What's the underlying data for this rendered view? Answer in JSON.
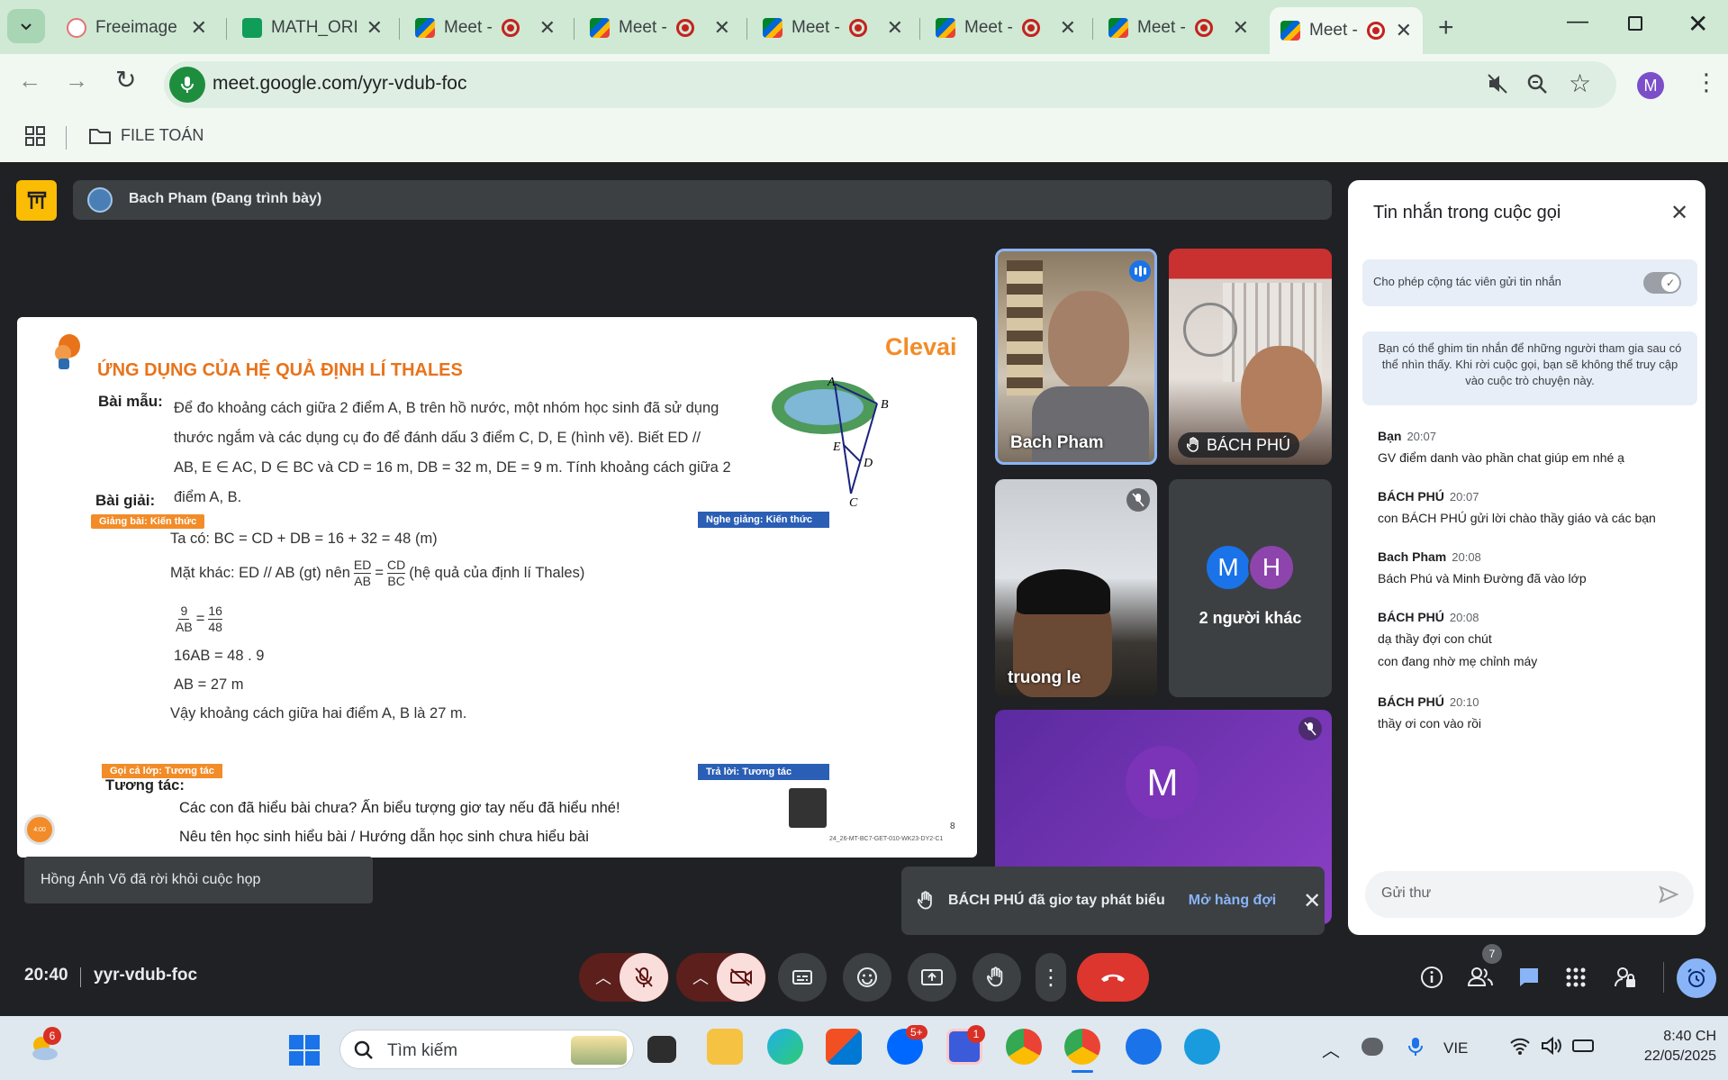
{
  "browser": {
    "tabs": [
      {
        "label": "Freeimage",
        "type": "free"
      },
      {
        "label": "MATH_ORI",
        "type": "sheet"
      },
      {
        "label": "Meet -",
        "type": "meet"
      },
      {
        "label": "Meet -",
        "type": "meet"
      },
      {
        "label": "Meet -",
        "type": "meet"
      },
      {
        "label": "Meet -",
        "type": "meet"
      },
      {
        "label": "Meet -",
        "type": "meet"
      },
      {
        "label": "Meet -",
        "type": "meet",
        "active": true
      }
    ],
    "url": "meet.google.com/yyr-vdub-foc",
    "bookmark_folder": "FILE TOÁN",
    "profile_initial": "M",
    "colors": {
      "tabbar": "#cfe9d4",
      "toolbar": "#f1f8f2"
    }
  },
  "presenter_bar": {
    "label": "Bach Pham (Đang trình bày)"
  },
  "slide": {
    "brand": "Clevai",
    "title": "ỨNG DỤNG CỦA HỆ QUẢ ĐỊNH LÍ THALES",
    "example_label": "Bài mẫu:",
    "example_text_lines": [
      "Để đo khoảng cách giữa 2 điểm A, B trên hồ nước, một nhóm học sinh đã sử dụng",
      "thước ngắm và các dụng cụ đo để đánh dấu 3 điểm C, D, E (hình vẽ). Biết ED //",
      "AB, E ∈ AC, D ∈ BC và CD = 16 m, DB = 32 m, DE = 9 m. Tính khoảng cách giữa 2",
      "điểm A, B."
    ],
    "solution_label": "Bài giải:",
    "tag_teach": "Giảng bài: Kiến thức",
    "tag_listen": "Nghe giảng: Kiến thức",
    "solution_lines": {
      "l1": "Ta có: BC = CD + DB = 16 + 32 = 48 (m)",
      "l2_a": "Mặt khác: ED // AB (gt) nên",
      "l2_frac1_num": "ED",
      "l2_frac1_den": "AB",
      "l2_eq": "=",
      "l2_frac2_num": "CD",
      "l2_frac2_den": "BC",
      "l2_b": "(hệ quả của định lí Thales)",
      "l3_frac1_num": "9",
      "l3_frac1_den": "AB",
      "l3_eq": "=",
      "l3_frac2_num": "16",
      "l3_frac2_den": "48",
      "l4": "16AB = 48 . 9",
      "l5": "AB = 27 m",
      "l6": "Vậy khoảng cách giữa hai điểm A, B là 27 m."
    },
    "tag_call": "Gọi cả lớp: Tương tác",
    "tag_answer": "Trả lời: Tương tác",
    "interaction_label": "Tương tác:",
    "interaction_lines": [
      "Các con đã hiểu bài chưa? Ấn biểu tượng giơ tay nếu đã hiểu nhé!",
      "Nêu tên học sinh hiểu bài / Hướng dẫn học sinh chưa hiểu bài"
    ],
    "page_number": "8",
    "footer_code": "24_26-MT-BC7-GET-010-WK23-DY2-C1",
    "figure_points": {
      "A": "A",
      "B": "B",
      "C": "C",
      "D": "D",
      "E": "E"
    },
    "timer": "4:00"
  },
  "participants": [
    {
      "name": "Bach Pham",
      "speaking": true
    },
    {
      "name": "BÁCH PHÚ",
      "hand_raised": true
    },
    {
      "name": "truong le",
      "muted": true
    },
    {
      "name": "2 người khác",
      "avatars": [
        "M",
        "H"
      ],
      "avatar_colors": [
        "#1a73e8",
        "#8e44ad"
      ]
    },
    {
      "name": "M",
      "muted": true,
      "avatar": "M"
    }
  ],
  "toast_left": "Hồng Ánh Võ đã rời khỏi cuộc họp",
  "toast_hand": {
    "text": "BÁCH PHÚ đã giơ tay phát biểu",
    "action": "Mở hàng đợi"
  },
  "chat": {
    "title": "Tin nhắn trong cuộc gọi",
    "toggle_label": "Cho phép cộng tác viên gửi tin nhắn",
    "info": "Bạn có thể ghim tin nhắn để những người tham gia sau có thể nhìn thấy. Khi rời cuộc gọi, bạn sẽ không thể truy cập vào cuộc trò chuyện này.",
    "messages": [
      {
        "who": "Bạn",
        "time": "20:07",
        "lines": [
          "GV điểm danh vào phần chat giúp em nhé ạ"
        ]
      },
      {
        "who": "BÁCH PHÚ",
        "time": "20:07",
        "lines": [
          "con  BÁCH PHÚ gửi lời chào thầy giáo và các bạn"
        ]
      },
      {
        "who": "Bach Pham",
        "time": "20:08",
        "lines": [
          "Bách Phú và Minh Đường đã vào lớp"
        ]
      },
      {
        "who": "BÁCH PHÚ",
        "time": "20:08",
        "lines": [
          "dạ thầy đợi con chút",
          "con đang nhờ mẹ chỉnh máy"
        ]
      },
      {
        "who": "BÁCH PHÚ",
        "time": "20:10",
        "lines": [
          "thầy ơi con vào rồi"
        ]
      }
    ],
    "input_placeholder": "Gửi thư"
  },
  "meeting_info": {
    "time": "20:40",
    "code": "yyr-vdub-foc",
    "participant_count": "7"
  },
  "taskbar": {
    "search_placeholder": "Tìm kiếm",
    "weather_badge": "6",
    "zalo_badge": "5+",
    "app_badge": "1",
    "language": "VIE",
    "clock_time": "8:40 CH",
    "clock_date": "22/05/2025"
  }
}
